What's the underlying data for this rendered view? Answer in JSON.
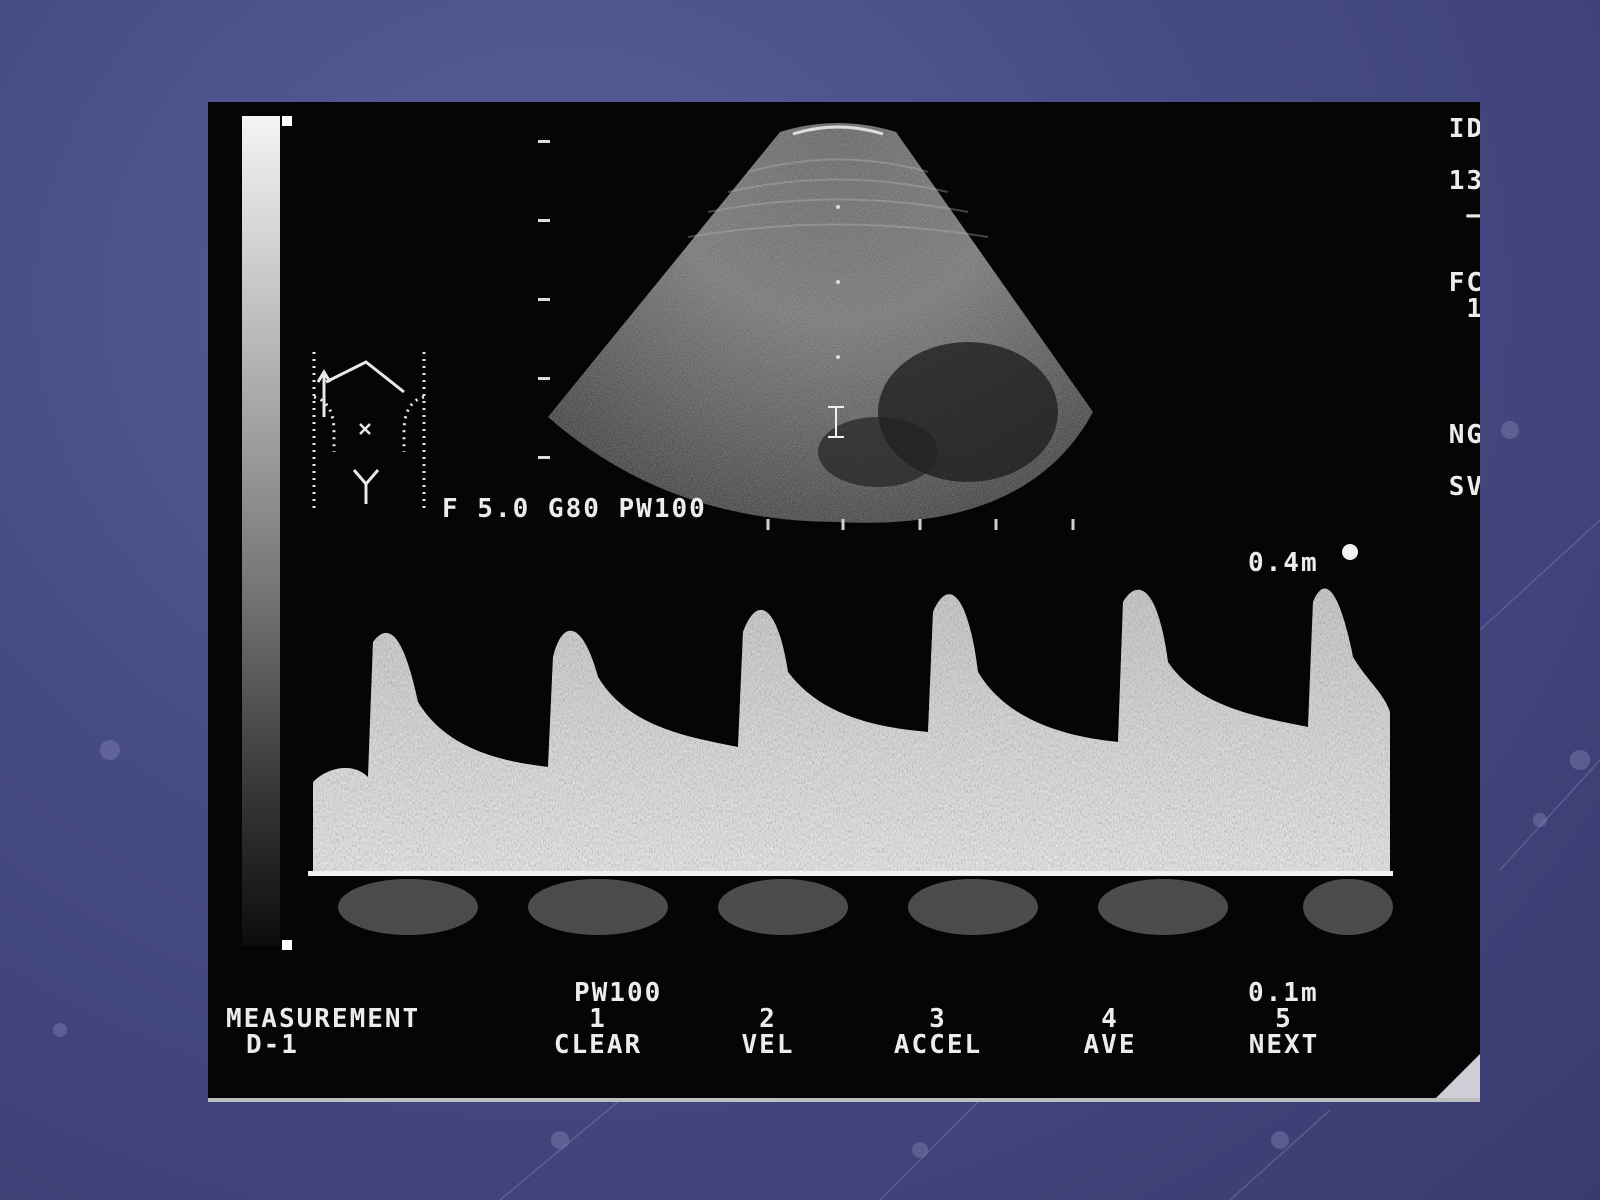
{
  "params": {
    "main": "F 5.0 G80 PW100",
    "top_scale": "0.4m",
    "bottom_mode": "PW100",
    "bottom_scale": "0.1m"
  },
  "measurement": {
    "title": "MEASUREMENT",
    "sub": "D-1"
  },
  "softkeys": [
    {
      "num": "1",
      "label": "CLEAR"
    },
    {
      "num": "2",
      "label": "VEL"
    },
    {
      "num": "3",
      "label": "ACCEL"
    },
    {
      "num": "4",
      "label": "AVE"
    },
    {
      "num": "5",
      "label": "NEXT"
    }
  ],
  "right_edge": [
    "ID",
    "13",
    "—",
    "FC",
    "1",
    "NG",
    "SV"
  ],
  "icon_names": [
    "grayscale-bar",
    "body-marker-icon",
    "doppler-sample-gate-icon",
    "doppler-spectrum",
    "sector-image"
  ]
}
